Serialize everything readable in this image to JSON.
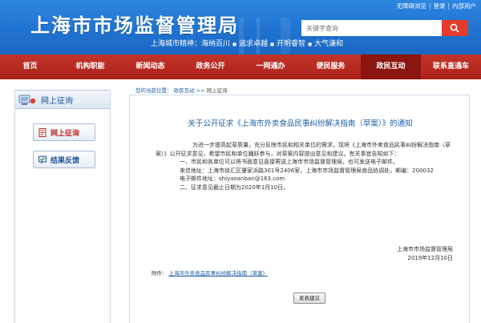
{
  "header": {
    "site_title": "上海市市场监督管理局",
    "slogan_prefix": "上海城市精神：",
    "slogan_items": [
      "海纳百川",
      "追求卓越",
      "开明睿智",
      "大气谦和"
    ],
    "top_links": [
      "无障碍浏览",
      "登录",
      "内部用户"
    ],
    "search_placeholder": "关键字查询"
  },
  "nav": {
    "items": [
      "首页",
      "机构职能",
      "新闻动态",
      "政务公开",
      "一网通办",
      "便民服务",
      "政民互动",
      "联系直通车"
    ],
    "active": "政民互动"
  },
  "sidebar": {
    "title": "网上征询",
    "buttons": [
      "网上征询",
      "结果反馈"
    ]
  },
  "breadcrumb": {
    "prefix": "您的当前位置：",
    "items": [
      "政民互动",
      "网上征询"
    ],
    "sep": ">>"
  },
  "article": {
    "title": "关于公开征求《上海市外卖食品民事纠纷解决指南（草案）》的通知",
    "para1": "为进一步提高起草质量，充分反映市民和相关单位的需求，现将《上海市外卖食品民事纠纷解决指南（草案）》公开征求意见，希望市民和单位踊跃参与，对草案内容提出意见和建议。有关事宜告知如下：",
    "item1": "一、市民和各单位可以将书面意见直接寄送上海市市场监督管理局，也可发送电子邮件。",
    "address": "来信地址：上海市徐汇区肇家浜路301号2406室，上海市市场监督管理局食品协调处，邮编：200032",
    "email": "电子邮件地址：shiyaoanban@163.com",
    "item2": "二、征求意见截止日期为2020年1月10日。",
    "signature_org": "上海市市场监督管理局",
    "signature_date": "2019年12月10日",
    "attachment_label": "附件：",
    "attachment_link": "上海市外卖食品民事纠纷解决指南（草案）",
    "submit_label": "发表建议"
  },
  "colors": {
    "header_blue": "#1f72cf",
    "nav_red": "#ad2219",
    "search_button": "#e53b2a",
    "link_blue": "#1c5fa8"
  }
}
